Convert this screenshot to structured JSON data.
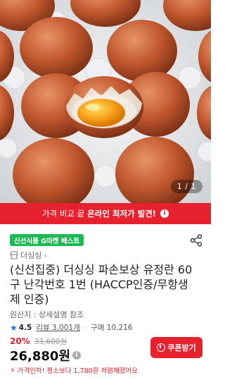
{
  "hero": {
    "image_counter": "1 / 1"
  },
  "banner": {
    "prefix": "가격 비교 끝",
    "highlight": "온라인 최저가 발견!",
    "info_icon": "info-icon"
  },
  "product": {
    "badge": "신선식품 G마켓 베스트",
    "brand": "더싱싱",
    "title": "(신선집중) 더싱싱 파손보상 유정란 60구 난각번호 1번 (HACCP인증/무항생제 인증)",
    "origin": "원산지 : 상세설명 참조",
    "rating": "4.5",
    "reviews": "리뷰 3,001개",
    "purchases": "구매 10,216",
    "discount": "20%",
    "original_price": "33,600원",
    "price": "26,880원",
    "coupon_label": "쿠폰받기",
    "price_cut_note": "가격인하! 평소보다 1,780원 저렴해졌어요"
  },
  "colors": {
    "accent_red": "#e8212e",
    "best_green": "#1db954",
    "rating_blue": "#1a73e8"
  },
  "icons": [
    "share-icon",
    "chevron-right-icon",
    "star-icon",
    "info-icon",
    "coupon-icon",
    "lightning-icon"
  ]
}
